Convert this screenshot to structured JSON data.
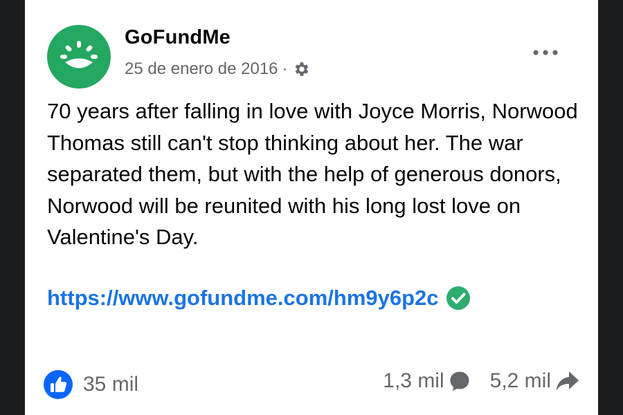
{
  "post": {
    "page_name": "GoFundMe",
    "date": "25 de enero de 2016",
    "separator": "·",
    "privacy_icon": "gear-icon",
    "more_icon": "more-options-icon",
    "text": "70 years after falling in love with Joyce Morris, Norwood Thomas still can't stop thinking about her. The war separated them, but with the help of generous donors, Norwood will be reunited with his long lost love on Valentine's Day.",
    "link": "https://www.gofundme.com/hm9y6p2c",
    "link_badge_icon": "check-circle-icon"
  },
  "footer": {
    "reaction_icon": "like-icon",
    "reactions_count": "35 mil",
    "comments_count": "1,3 mil",
    "comments_icon": "comment-bubble-icon",
    "shares_count": "5,2 mil",
    "shares_icon": "share-arrow-icon"
  },
  "colors": {
    "brand_green": "#24a760",
    "link_blue": "#1b74e4",
    "like_blue": "#0866ff",
    "muted_gray": "#65676b",
    "check_green": "#2eac6d"
  }
}
